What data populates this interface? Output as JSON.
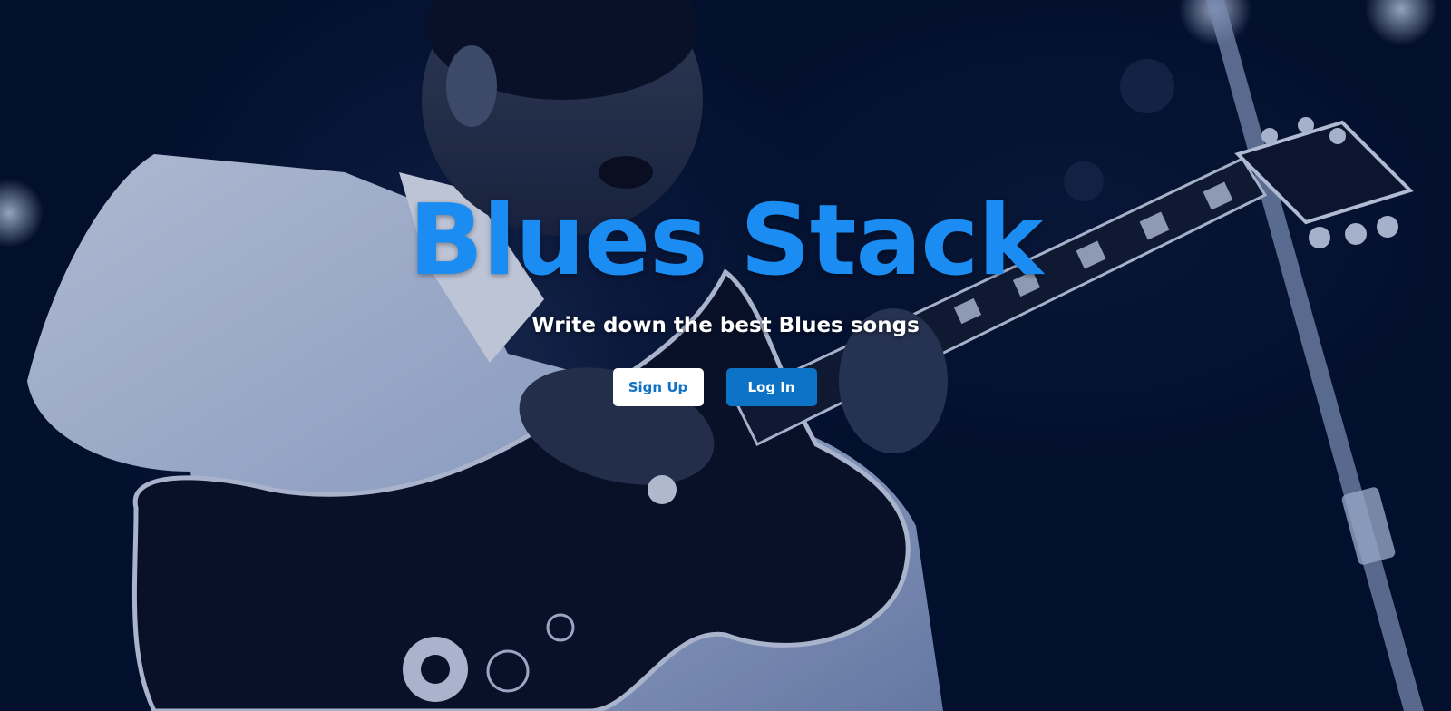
{
  "hero": {
    "title": "Blues Stack",
    "subtitle": "Write down the best Blues songs",
    "background_image": "guitarist-photo"
  },
  "actions": {
    "signup_label": "Sign Up",
    "login_label": "Log In"
  },
  "colors": {
    "title": "#1a8cf2",
    "login_button": "#0d73c7",
    "signup_text": "#1273c4",
    "background": "#020f2c"
  }
}
